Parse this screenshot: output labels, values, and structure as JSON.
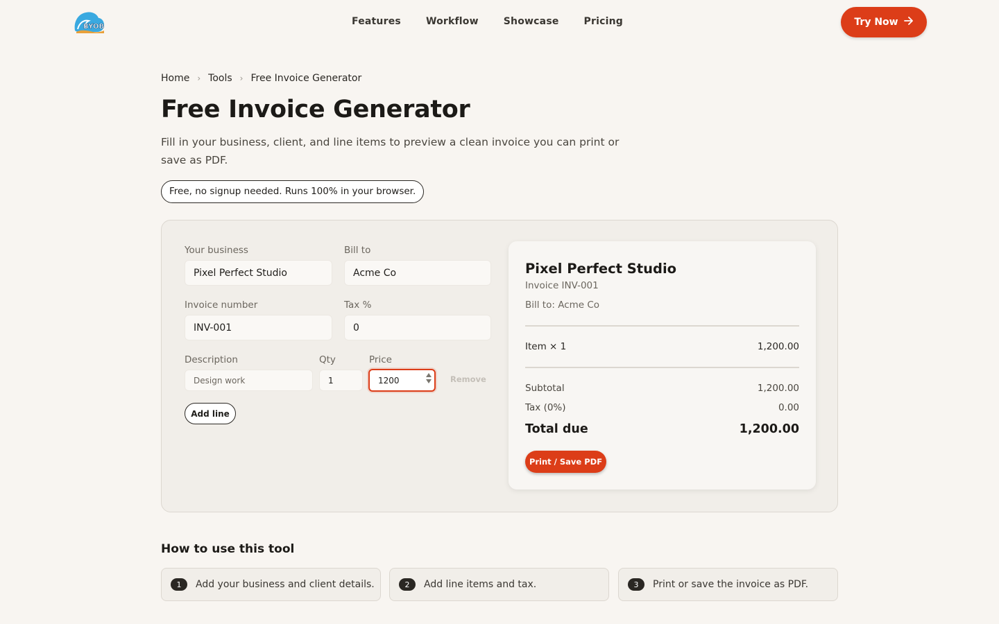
{
  "brand": {
    "logo_text": "BYOB"
  },
  "nav": {
    "items": [
      "Features",
      "Workflow",
      "Showcase",
      "Pricing"
    ],
    "cta_label": "Try Now"
  },
  "breadcrumb": [
    "Home",
    "Tools",
    "Free Invoice Generator"
  ],
  "page": {
    "title": "Free Invoice Generator",
    "description": "Fill in your business, client, and line items to preview a clean invoice you can print or save as PDF.",
    "pill": "Free, no signup needed. Runs 100% in your browser."
  },
  "form": {
    "business_label": "Your business",
    "business_value": "Pixel Perfect Studio",
    "bill_to_label": "Bill to",
    "bill_to_value": "Acme Co",
    "invoice_number_label": "Invoice number",
    "invoice_number_value": "INV-001",
    "tax_label": "Tax %",
    "tax_value": "0",
    "description_label": "Description",
    "qty_label": "Qty",
    "price_label": "Price",
    "line_description_placeholder": "Design work",
    "line_qty_value": "1",
    "line_price_value": "1200",
    "remove_label": "Remove",
    "add_line_label": "Add line"
  },
  "preview": {
    "business": "Pixel Perfect Studio",
    "invoice": "Invoice INV-001",
    "bill_to": "Bill to: Acme Co",
    "item_label": "Item × 1",
    "item_amount": "1,200.00",
    "subtotal_label": "Subtotal",
    "subtotal_value": "1,200.00",
    "tax_label": "Tax (0%)",
    "tax_value": "0.00",
    "total_label": "Total due",
    "total_value": "1,200.00",
    "print_label": "Print / Save PDF"
  },
  "how": {
    "title": "How to use this tool",
    "steps": [
      {
        "num": "1",
        "text": "Add your business and client details."
      },
      {
        "num": "2",
        "text": "Add line items and tax."
      },
      {
        "num": "3",
        "text": "Print or save the invoice as PDF."
      }
    ]
  },
  "colors": {
    "accent": "#dc3d18",
    "background": "#f8f5f1",
    "card": "#f1eee9"
  }
}
